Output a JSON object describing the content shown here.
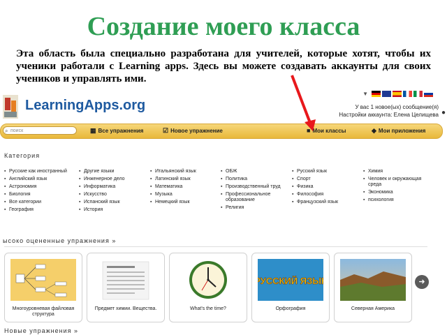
{
  "slide": {
    "title": "Создание моего класса",
    "description": "Эта область была специально разработана для учителей, которые хотят, чтобы их ученики работали с Learning apps. Здесь вы можете создавать аккаунты для своих учеников и управлять ими."
  },
  "site": {
    "brand": "LearningApps.org",
    "user_messages": "У вас 1 новое(ых) сообщение(я)",
    "account_settings": "Настройки аккаунта: Елена Целищева",
    "search_placeholder": "поиск",
    "nav": {
      "all_exercises": "Все упражнения",
      "new_exercise": "Новое упражнение",
      "my_classes": "Мои классы",
      "my_apps": "Мои приложения"
    },
    "flags": [
      "#c0392b",
      "#1f3a93",
      "#d4a017",
      "#2c5aa0",
      "#1e8449",
      "#e8d8d8"
    ]
  },
  "category": {
    "title": "Категория",
    "columns": [
      [
        "Русские как иностранный",
        "Английский язык",
        "Астрономия",
        "Биология",
        "Все категории",
        "География"
      ],
      [
        "Другие языки",
        "Инженерное дело",
        "Информатика",
        "Искусство",
        "Испанский язык",
        "История"
      ],
      [
        "Итальянский язык",
        "Латинский язык",
        "Математика",
        "Музыка",
        "Немецкий язык"
      ],
      [
        "ОБЖ",
        "Политика",
        "Производственный труд",
        "Профессиональное образование",
        "Религия"
      ],
      [
        "Русский язык",
        "Спорт",
        "Физика",
        "Философия",
        "Французский язык"
      ],
      [
        "Химия",
        "Человек и окружающая среда",
        "Экономика",
        "психология"
      ]
    ]
  },
  "top_rated": {
    "title": "ысоко оцененные упражнения »",
    "cards": [
      "Многоуровневая файловая структура",
      "Предмет химии. Вещества.",
      "What's the time?",
      "Орфография",
      "Северная Америка"
    ],
    "russian_text": "РУССКИЙ ЯЗЫК"
  },
  "bottom_title": "Новые упражнения »"
}
